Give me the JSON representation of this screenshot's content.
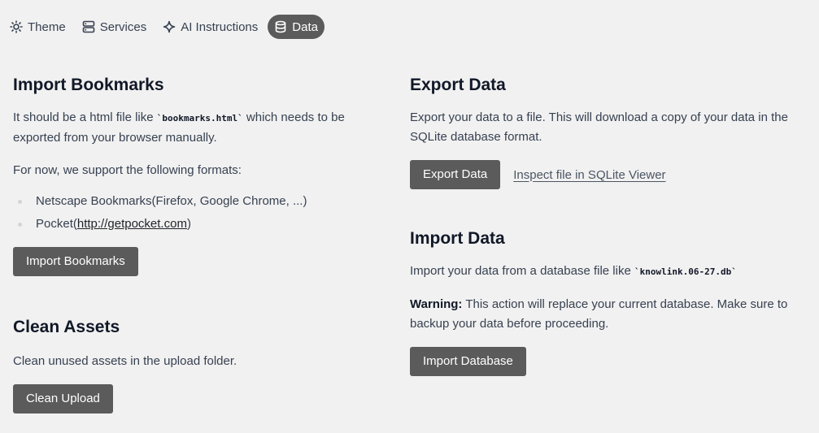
{
  "tabs": [
    {
      "label": "Theme",
      "icon": "sun-icon",
      "active": false
    },
    {
      "label": "Services",
      "icon": "server-icon",
      "active": false
    },
    {
      "label": "AI Instructions",
      "icon": "sparkle-icon",
      "active": false
    },
    {
      "label": "Data",
      "icon": "database-icon",
      "active": true
    }
  ],
  "import_bookmarks": {
    "title": "Import Bookmarks",
    "desc_pre": "It should be a html file like ",
    "desc_code": "`bookmarks.html`",
    "desc_post": " which needs to be exported from your browser manually.",
    "formats_intro": "For now, we support the following formats:",
    "formats": [
      {
        "text": "Netscape Bookmarks(Firefox, Google Chrome, ...)"
      },
      {
        "text_pre": "Pocket(",
        "link": "http://getpocket.com",
        "text_post": ")"
      }
    ],
    "button": "Import Bookmarks"
  },
  "clean_assets": {
    "title": "Clean Assets",
    "desc": "Clean unused assets in the upload folder.",
    "button": "Clean Upload"
  },
  "export_data": {
    "title": "Export Data",
    "desc": "Export your data to a file. This will download a copy of your data in the SQLite database format.",
    "button": "Export Data",
    "link": "Inspect file in SQLite Viewer"
  },
  "import_data": {
    "title": "Import Data",
    "desc_pre": "Import your data from a database file like ",
    "desc_code": "`knowlink.06-27.db`",
    "warning_label": "Warning:",
    "warning_text": " This action will replace your current database. Make sure to backup your data before proceeding.",
    "button": "Import Database"
  }
}
